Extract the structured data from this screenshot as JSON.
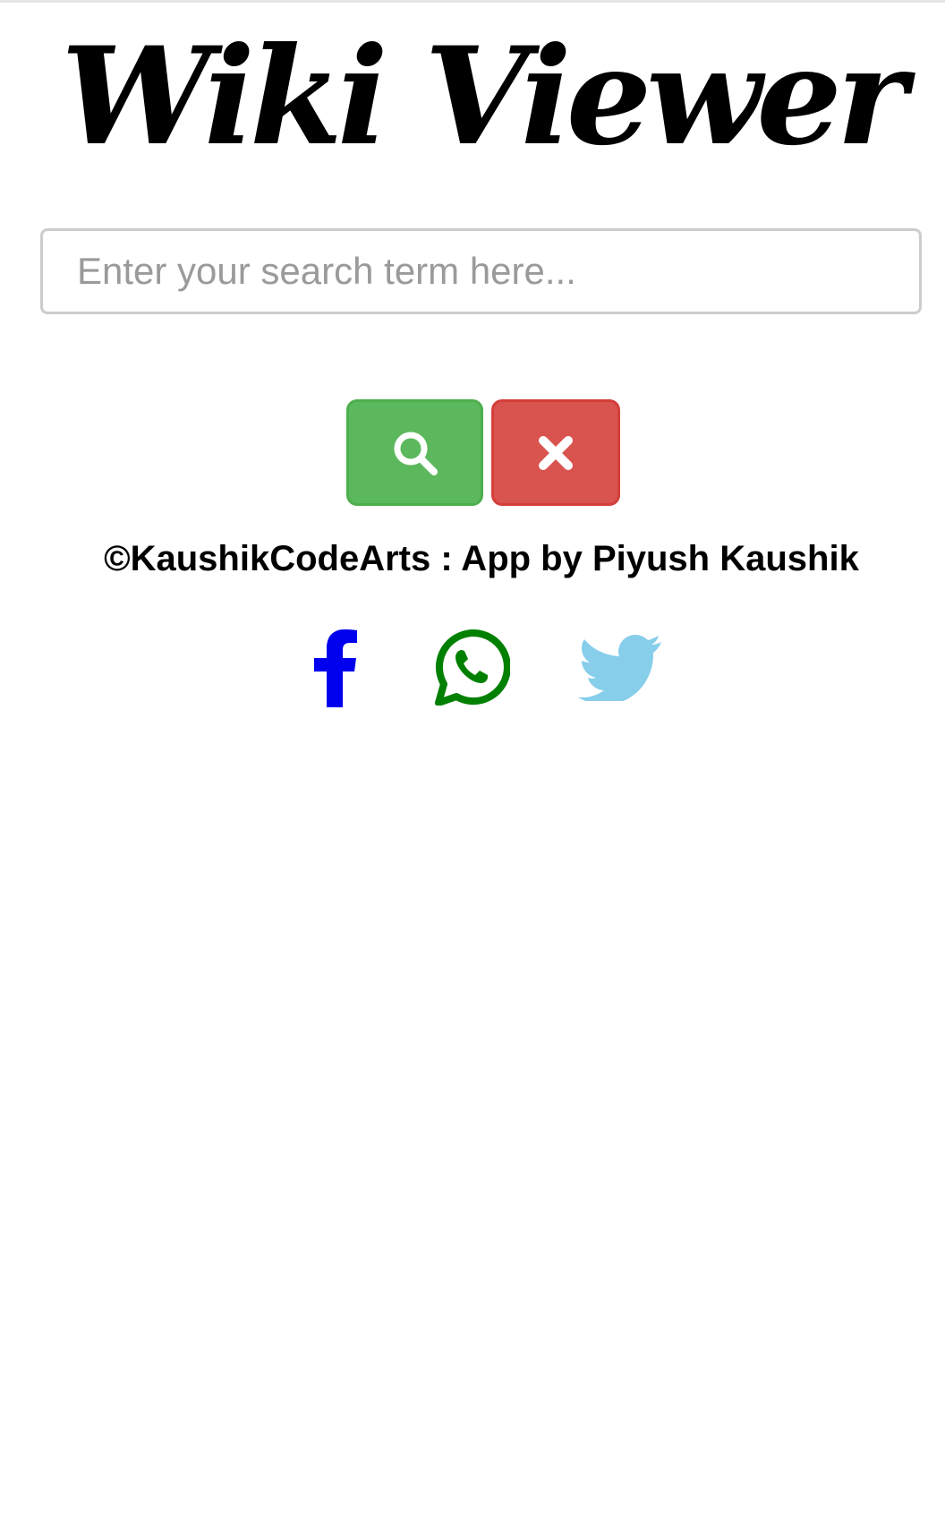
{
  "header": {
    "title": "Wiki Viewer"
  },
  "search": {
    "placeholder": "Enter your search term here...",
    "value": ""
  },
  "buttons": {
    "search_icon": "search-icon",
    "clear_icon": "times-icon",
    "search_color": "#5cb85c",
    "clear_color": "#d9534f"
  },
  "footer": {
    "credit": "©KaushikCodeArts : App by Piyush Kaushik"
  },
  "social": {
    "items": [
      {
        "icon": "facebook-icon",
        "color": "#0000ee"
      },
      {
        "icon": "whatsapp-icon",
        "color": "#008000"
      },
      {
        "icon": "twitter-icon",
        "color": "#87ceeb"
      }
    ]
  }
}
